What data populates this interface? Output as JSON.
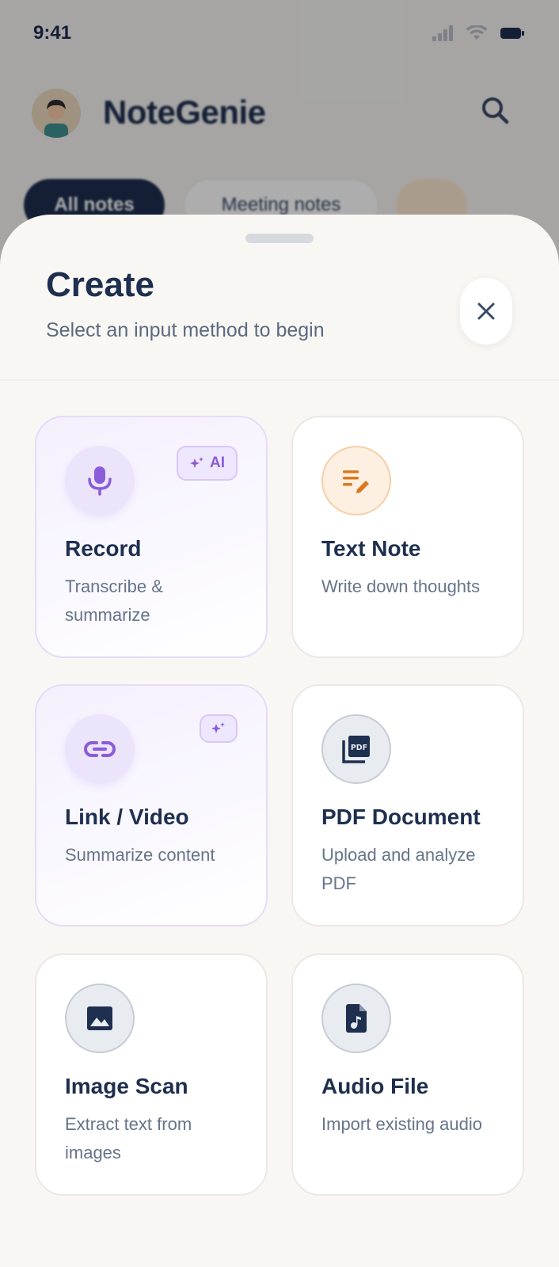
{
  "status_bar": {
    "time": "9:41"
  },
  "app": {
    "brand": "NoteGenie",
    "filters": [
      "All notes",
      "Meeting notes"
    ]
  },
  "sheet": {
    "title": "Create",
    "subtitle": "Select an input method to begin",
    "close_icon": "close-icon"
  },
  "colors": {
    "navy": "#1e2f4f",
    "purple_accent": "#8a5cd9",
    "orange_accent": "#d9791f",
    "sheet_bg": "#f9f7f3"
  },
  "options": [
    {
      "title": "Record",
      "description": "Transcribe & summarize",
      "icon": "microphone-icon",
      "ai": true,
      "badge": "AI"
    },
    {
      "title": "Text Note",
      "description": "Write down thoughts",
      "icon": "edit-note-icon",
      "ai": false
    },
    {
      "title": "Link / Video",
      "description": "Summarize content",
      "icon": "link-icon",
      "ai": true,
      "badge": ""
    },
    {
      "title": "PDF Document",
      "description": "Upload and analyze PDF",
      "icon": "pdf-icon",
      "ai": false
    },
    {
      "title": "Image Scan",
      "description": "Extract text from images",
      "icon": "image-icon",
      "ai": false
    },
    {
      "title": "Audio File",
      "description": "Import existing audio",
      "icon": "audio-file-icon",
      "ai": false
    }
  ]
}
